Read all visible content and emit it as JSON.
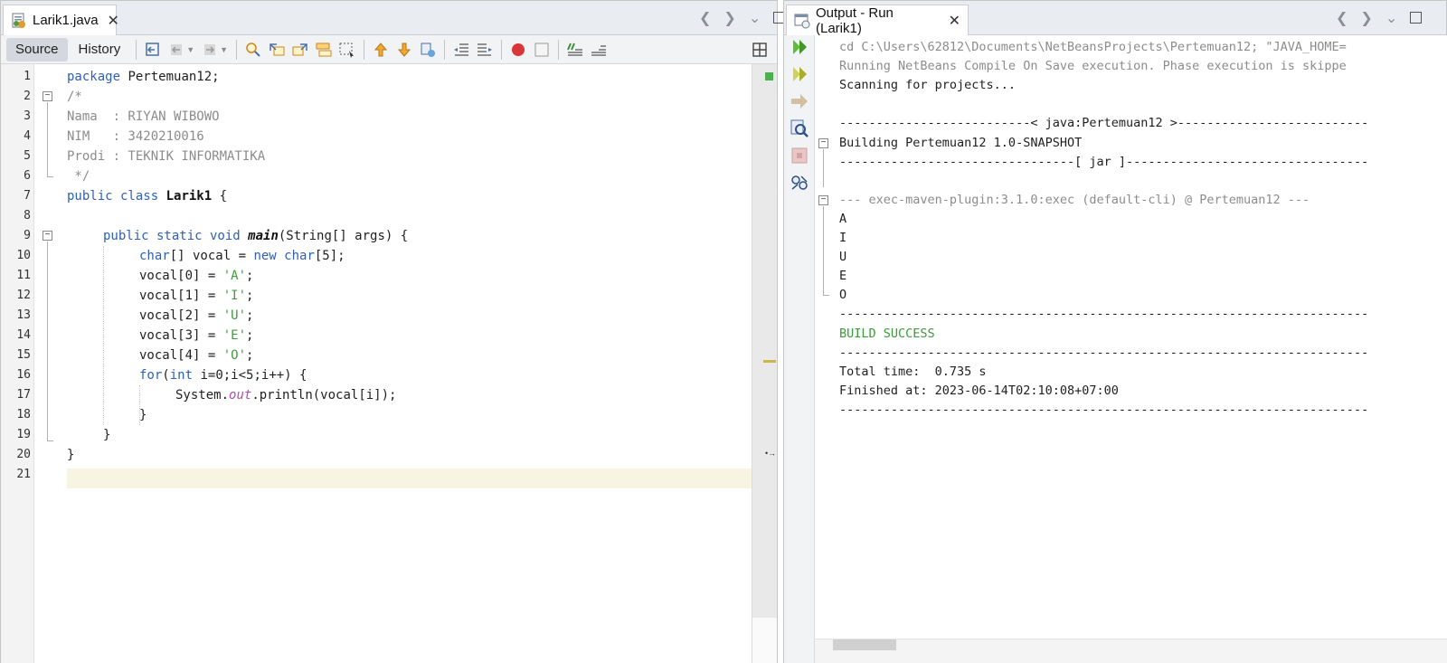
{
  "editor": {
    "tab_title": "Larik1.java",
    "view_buttons": {
      "source": "Source",
      "history": "History"
    },
    "line_numbers": [
      "1",
      "2",
      "3",
      "4",
      "5",
      "6",
      "7",
      "8",
      "9",
      "10",
      "11",
      "12",
      "13",
      "14",
      "15",
      "16",
      "17",
      "18",
      "19",
      "20",
      "21"
    ],
    "toolbar_icons": [
      "last-edit-icon",
      "back-icon",
      "forward-icon",
      "find-icon",
      "find-previous-icon",
      "find-next-icon",
      "toggle-highlight-icon",
      "toggle-rect-selection-icon",
      "previous-bookmark-icon",
      "next-bookmark-icon",
      "toggle-bookmark-icon",
      "shift-left-icon",
      "shift-right-icon",
      "start-macro-icon",
      "stop-macro-icon",
      "comment-icon",
      "uncomment-icon"
    ]
  },
  "code": {
    "l1_kw": "package",
    "l1_rest": " Pertemuan12;",
    "l2": "/*",
    "l3": "Nama  : RIYAN WIBOWO",
    "l4": "NIM   : 3420210016",
    "l5": "Prodi : TEKNIK INFORMATIKA",
    "l6": " */",
    "l7_kw": "public class",
    "l7_cls": "Larik1",
    "l7_rest": " {",
    "l9_kw": "public static void",
    "l9_name": "main",
    "l9_rest": "(String[] args) {",
    "l10_kw1": "char",
    "l10_mid": "[] vocal = ",
    "l10_kw2": "new char",
    "l10_end": "[5];",
    "l11_pre": "vocal[0] = ",
    "l11_str": "'A'",
    "l12_pre": "vocal[1] = ",
    "l12_str": "'I'",
    "l13_pre": "vocal[2] = ",
    "l13_str": "'U'",
    "l14_pre": "vocal[3] = ",
    "l14_str": "'E'",
    "l15_pre": "vocal[4] = ",
    "l15_str": "'O'",
    "semicolon": ";",
    "l16_kw1": "for",
    "l16_p": "(",
    "l16_kw2": "int",
    "l16_rest": " i=0;i<5;i++) {",
    "l17_pre": "System.",
    "l17_fld": "out",
    "l17_rest": ".println(vocal[i]);",
    "l18": "}",
    "l19": "}",
    "l20": "}"
  },
  "output": {
    "tab_title": "Output - Run (Larik1)",
    "lines": [
      {
        "text": "cd C:\\Users\\62812\\Documents\\NetBeansProjects\\Pertemuan12; \"JAVA_HOME=",
        "style": "dim"
      },
      {
        "text": "Running NetBeans Compile On Save execution. Phase execution is skippe",
        "style": "dim"
      },
      {
        "text": "Scanning for projects...",
        "style": "normal"
      },
      {
        "text": "",
        "style": "normal"
      },
      {
        "text": "--------------------------< java:Pertemuan12 >--------------------------",
        "style": "normal"
      },
      {
        "text": "Building Pertemuan12 1.0-SNAPSHOT",
        "style": "normal"
      },
      {
        "text": "--------------------------------[ jar ]---------------------------------",
        "style": "normal"
      },
      {
        "text": "",
        "style": "normal"
      },
      {
        "text": "--- exec-maven-plugin:3.1.0:exec (default-cli) @ Pertemuan12 ---",
        "style": "dim"
      },
      {
        "text": "A",
        "style": "normal"
      },
      {
        "text": "I",
        "style": "normal"
      },
      {
        "text": "U",
        "style": "normal"
      },
      {
        "text": "E",
        "style": "normal"
      },
      {
        "text": "O",
        "style": "normal"
      },
      {
        "text": "------------------------------------------------------------------------",
        "style": "normal"
      },
      {
        "text": "BUILD SUCCESS",
        "style": "green"
      },
      {
        "text": "------------------------------------------------------------------------",
        "style": "normal"
      },
      {
        "text": "Total time:  0.735 s",
        "style": "normal"
      },
      {
        "text": "Finished at: 2023-06-14T02:10:08+07:00",
        "style": "normal"
      },
      {
        "text": "------------------------------------------------------------------------",
        "style": "normal"
      }
    ],
    "side_icons": [
      "rerun-icon",
      "rerun-with-options-icon",
      "continue-icon",
      "find-icon",
      "stop-icon",
      "settings-icon"
    ]
  },
  "colors": {
    "keyword": "#2f5fb6",
    "comment": "#8c8c8c",
    "string": "#3f9c3f",
    "field": "#b34ab3",
    "current_line": "#f8f4e2",
    "success": "#3b9a3b"
  }
}
